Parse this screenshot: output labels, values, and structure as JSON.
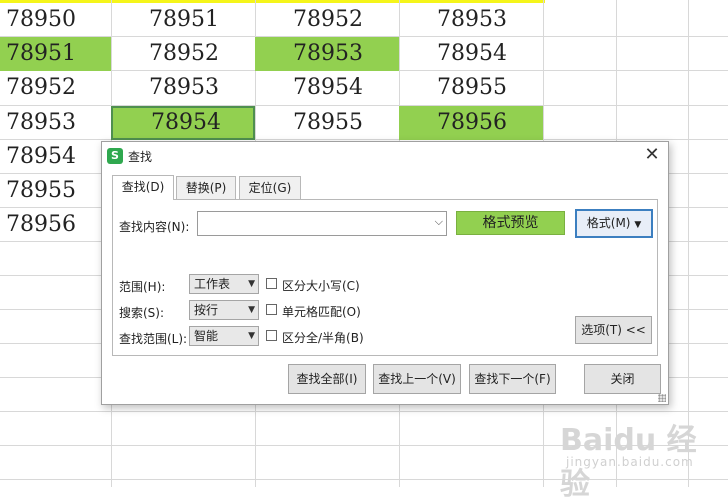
{
  "spreadsheet": {
    "rows": [
      {
        "cells": [
          {
            "v": "78950",
            "g": false
          },
          {
            "v": "78951",
            "g": false
          },
          {
            "v": "78952",
            "g": false
          },
          {
            "v": "78953",
            "g": false
          }
        ]
      },
      {
        "cells": [
          {
            "v": "78951",
            "g": true
          },
          {
            "v": "78952",
            "g": false
          },
          {
            "v": "78953",
            "g": true
          },
          {
            "v": "78954",
            "g": false
          }
        ]
      },
      {
        "cells": [
          {
            "v": "78952",
            "g": false
          },
          {
            "v": "78953",
            "g": false
          },
          {
            "v": "78954",
            "g": false
          },
          {
            "v": "78955",
            "g": false
          }
        ]
      },
      {
        "cells": [
          {
            "v": "78953",
            "g": false
          },
          {
            "v": "78954",
            "g": true,
            "selected": true
          },
          {
            "v": "78955",
            "g": false
          },
          {
            "v": "78956",
            "g": true
          }
        ]
      },
      {
        "cells": [
          {
            "v": "78954"
          }
        ]
      },
      {
        "cells": [
          {
            "v": "78955"
          }
        ]
      },
      {
        "cells": [
          {
            "v": "78956"
          }
        ]
      }
    ],
    "highlight_color": "#92d050",
    "header_line_color": "#f5f51a"
  },
  "dialog": {
    "icon": "wps-s-icon",
    "icon_letter": "S",
    "title": "查找",
    "close_glyph": "✕",
    "tabs": [
      {
        "label": "查找(D)",
        "active": true
      },
      {
        "label": "替换(P)",
        "active": false
      },
      {
        "label": "定位(G)",
        "active": false
      }
    ],
    "find_label": "查找内容(N):",
    "find_value": "",
    "format_preview": "格式预览",
    "format_button": "格式(M)",
    "scope_label": "范围(H):",
    "scope_value": "工作表",
    "search_label": "搜索(S):",
    "search_value": "按行",
    "lookin_label": "查找范围(L):",
    "lookin_value": "智能",
    "match_case": {
      "label": "区分大小写(C)",
      "checked": false
    },
    "match_cell": {
      "label": "单元格匹配(O)",
      "checked": false
    },
    "match_width": {
      "label": "区分全/半角(B)",
      "checked": false
    },
    "options_button": "选项(T) <<",
    "find_all": "查找全部(I)",
    "find_prev": "查找上一个(V)",
    "find_next": "查找下一个(F)",
    "close_button": "关闭"
  },
  "watermark": {
    "text": "Baidu 经验",
    "sub": "jingyan.baidu.com"
  }
}
